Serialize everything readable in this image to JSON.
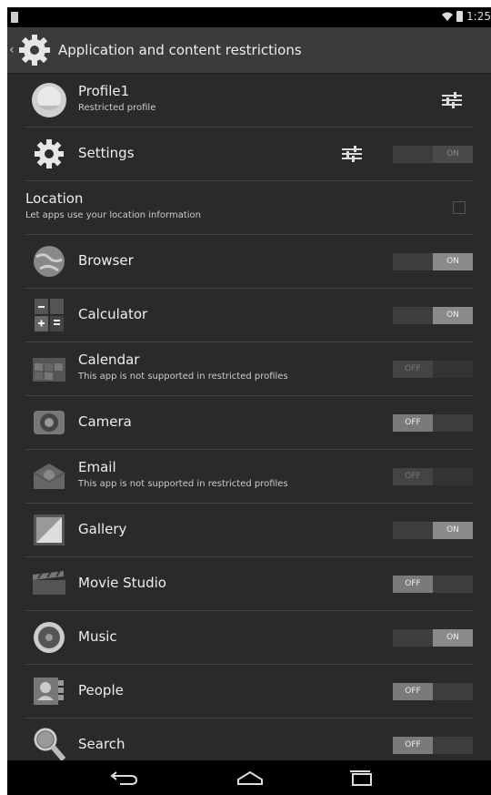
{
  "status": {
    "time": "1:25"
  },
  "header": {
    "title": "Application and content restrictions"
  },
  "profile": {
    "name": "Profile1",
    "subtitle": "Restricted profile"
  },
  "settings": {
    "label": "Settings",
    "toggle": "ON"
  },
  "location": {
    "title": "Location",
    "subtitle": "Let apps use your location information"
  },
  "apps": [
    {
      "name": "Browser",
      "subtitle": "",
      "toggle": "ON",
      "state": "on",
      "icon": "browser-icon"
    },
    {
      "name": "Calculator",
      "subtitle": "",
      "toggle": "ON",
      "state": "on",
      "icon": "calculator-icon"
    },
    {
      "name": "Calendar",
      "subtitle": "This app is not supported in restricted profiles",
      "toggle": "OFF",
      "state": "disabled",
      "icon": "calendar-icon"
    },
    {
      "name": "Camera",
      "subtitle": "",
      "toggle": "OFF",
      "state": "off",
      "icon": "camera-icon"
    },
    {
      "name": "Email",
      "subtitle": "This app is not supported in restricted profiles",
      "toggle": "OFF",
      "state": "disabled",
      "icon": "email-icon"
    },
    {
      "name": "Gallery",
      "subtitle": "",
      "toggle": "ON",
      "state": "on",
      "icon": "gallery-icon"
    },
    {
      "name": "Movie Studio",
      "subtitle": "",
      "toggle": "OFF",
      "state": "off",
      "icon": "movie-studio-icon"
    },
    {
      "name": "Music",
      "subtitle": "",
      "toggle": "ON",
      "state": "on",
      "icon": "music-icon"
    },
    {
      "name": "People",
      "subtitle": "",
      "toggle": "OFF",
      "state": "off",
      "icon": "people-icon"
    },
    {
      "name": "Search",
      "subtitle": "",
      "toggle": "OFF",
      "state": "off",
      "icon": "search-icon"
    }
  ],
  "navbar": {
    "back": "back-icon",
    "home": "home-icon",
    "recents": "recents-icon"
  }
}
